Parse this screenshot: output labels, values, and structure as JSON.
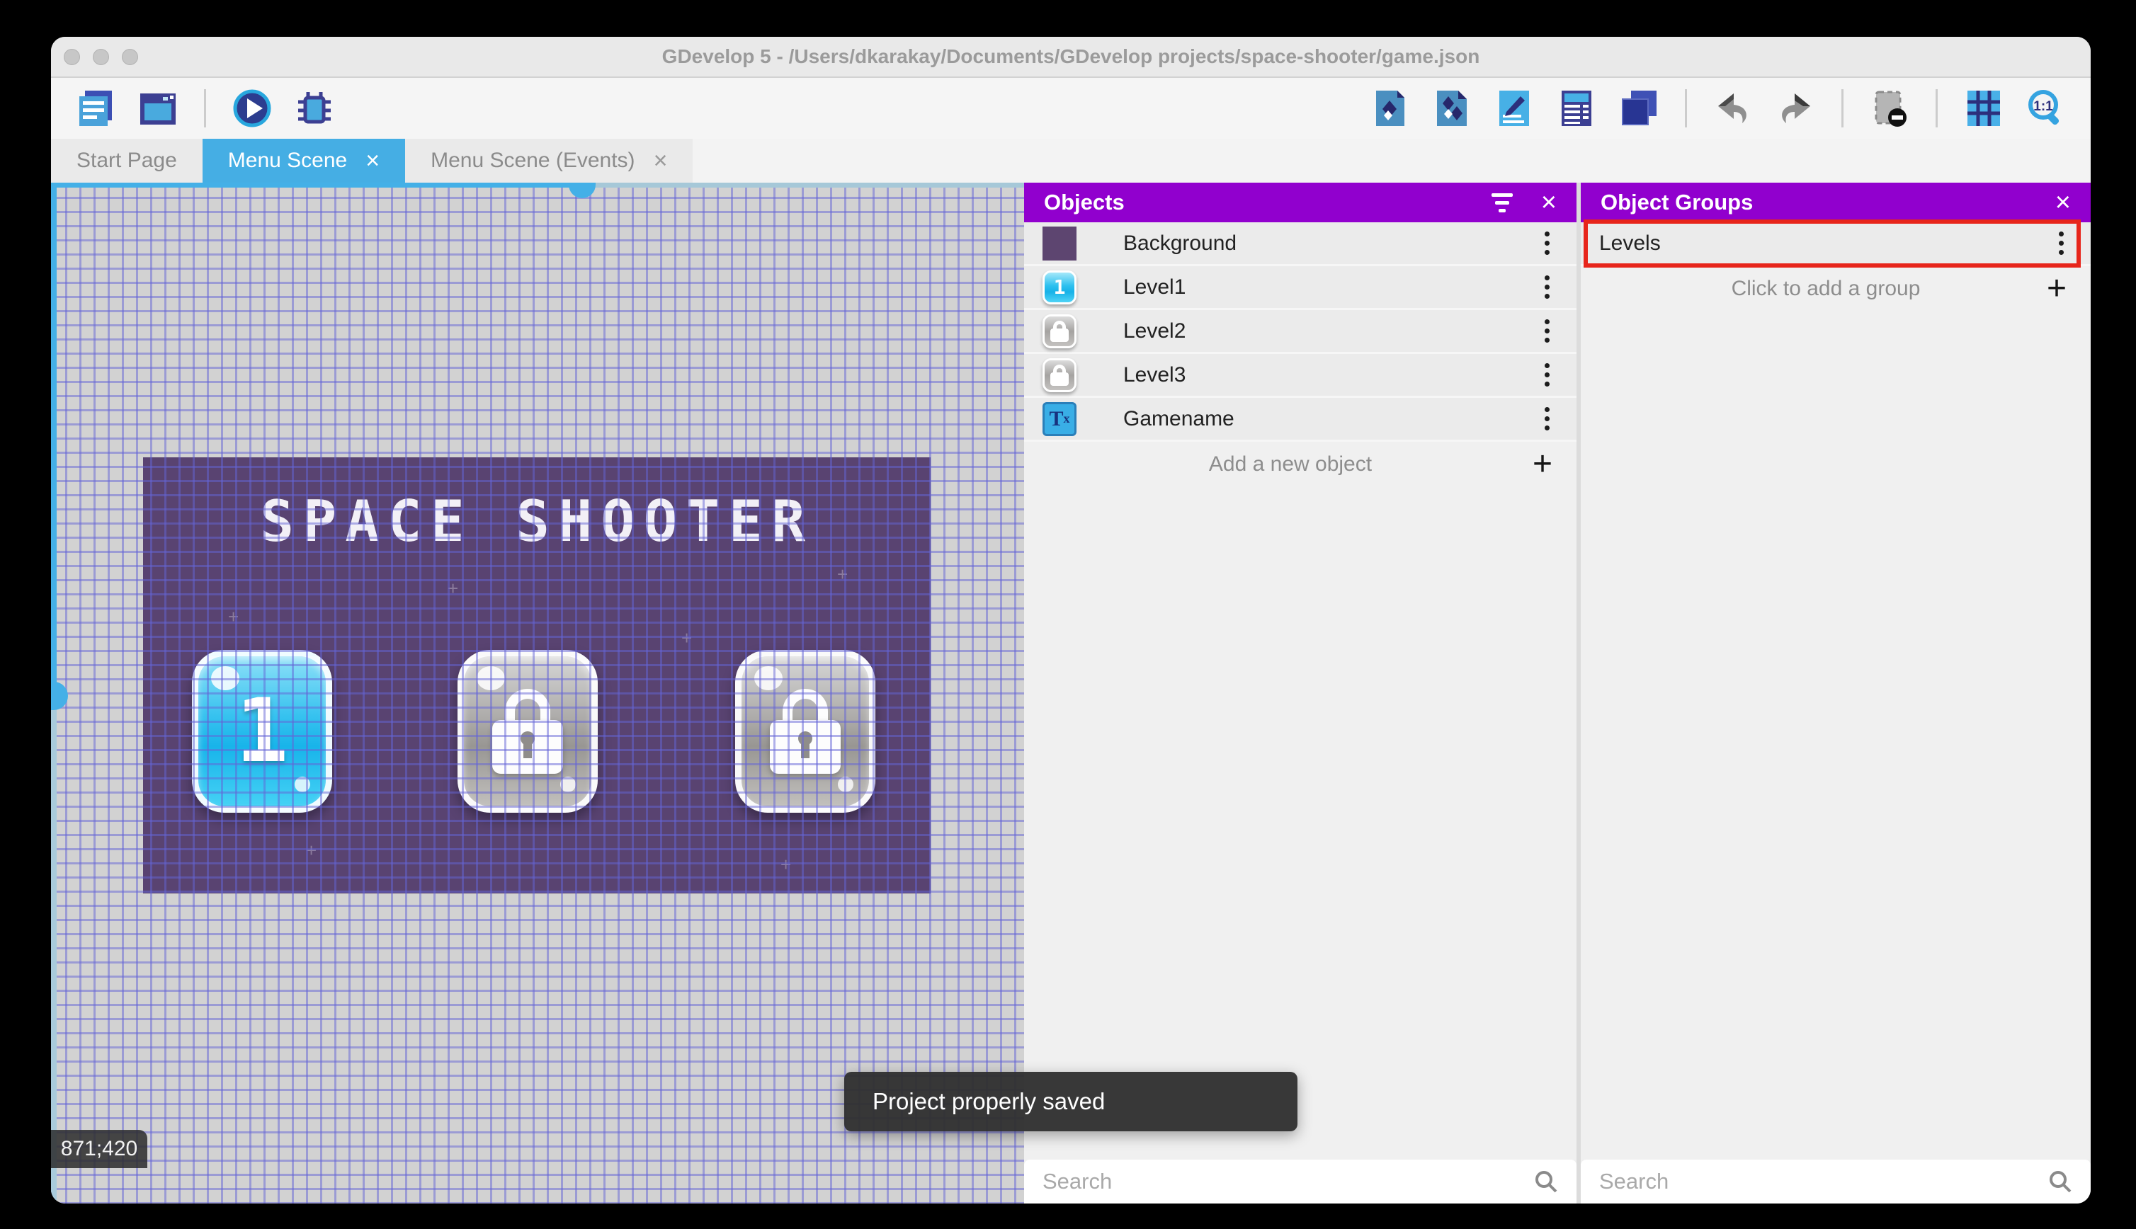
{
  "window": {
    "title": "GDevelop 5 - /Users/dkarakay/Documents/GDevelop projects/space-shooter/game.json"
  },
  "toolbar": {
    "left_icons": [
      "project-manager",
      "scene-editor",
      "play",
      "debug"
    ],
    "right_icons": [
      "objects-editor",
      "object-groups",
      "properties",
      "instances-list",
      "layers",
      "undo",
      "redo",
      "toggle-instances-mask",
      "grid",
      "zoom-1-1"
    ]
  },
  "tabs": [
    {
      "label": "Start Page",
      "active": false,
      "closable": false
    },
    {
      "label": "Menu Scene",
      "active": true,
      "closable": true
    },
    {
      "label": "Menu Scene (Events)",
      "active": false,
      "closable": true
    }
  ],
  "canvas": {
    "scene_title": "SPACE SHOOTER",
    "buttons": [
      {
        "label": "1",
        "state": "unlocked"
      },
      {
        "state": "locked"
      },
      {
        "state": "locked"
      }
    ],
    "coordinates": "871;420"
  },
  "objects_panel": {
    "title": "Objects",
    "rows": [
      {
        "label": "Background",
        "icon": "purple-square-thumbnail"
      },
      {
        "label": "Level1",
        "icon": "level-button-thumbnail"
      },
      {
        "label": "Level2",
        "icon": "lock-button-thumbnail"
      },
      {
        "label": "Level3",
        "icon": "lock-button-thumbnail"
      },
      {
        "label": "Gamename",
        "icon": "text-object-thumbnail"
      }
    ],
    "add_label": "Add a new object",
    "search_placeholder": "Search"
  },
  "groups_panel": {
    "title": "Object Groups",
    "rows": [
      {
        "label": "Levels"
      }
    ],
    "add_label": "Click to add a group",
    "search_placeholder": "Search"
  },
  "toast": {
    "message": "Project properly saved"
  },
  "colors": {
    "panel_header": "#9100ce",
    "active_tab": "#45aee4",
    "annotation_red": "#e7251b",
    "scene_background": "#594371",
    "toast_background": "#303030"
  }
}
